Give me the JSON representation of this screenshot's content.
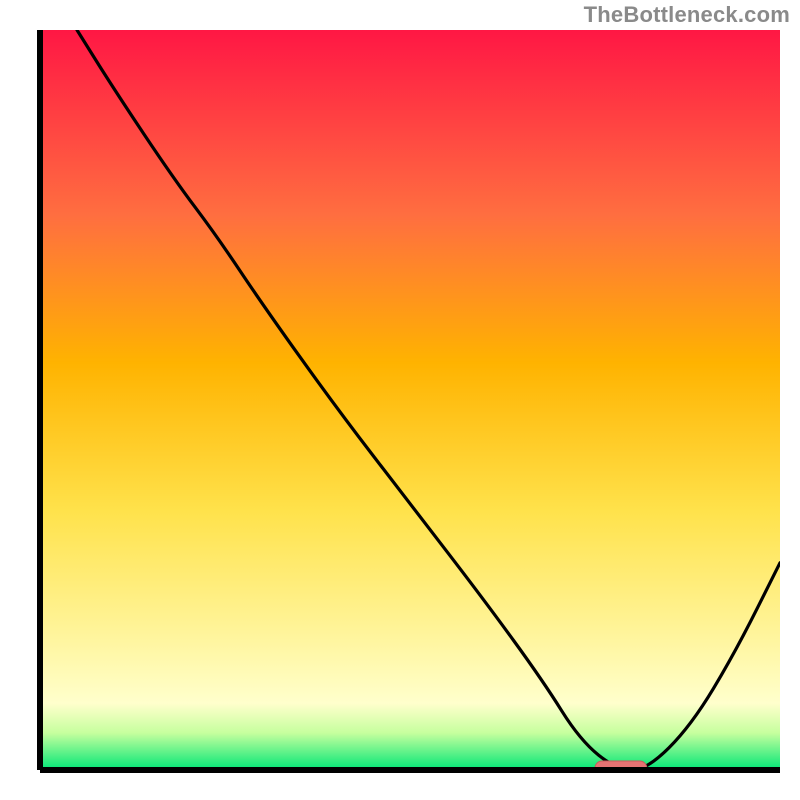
{
  "watermark": "TheBottleneck.com",
  "colors": {
    "gradient_top": "#ff1744",
    "gradient_upper_mid": "#ff8a3c",
    "gradient_mid": "#ffd740",
    "gradient_lower_mid": "#fff176",
    "gradient_pale": "#ffffcc",
    "gradient_bottom": "#00e676",
    "axis": "#000000",
    "curve": "#000000",
    "marker_fill": "#e57373",
    "marker_stroke": "#c75b5b"
  },
  "chart_data": {
    "type": "line",
    "title": "",
    "xlabel": "",
    "ylabel": "",
    "xlim": [
      0,
      100
    ],
    "ylim": [
      0,
      100
    ],
    "x": [
      5,
      10,
      18,
      24,
      30,
      40,
      50,
      60,
      68,
      73,
      78,
      82,
      88,
      94,
      100
    ],
    "values": [
      100,
      92,
      80,
      72,
      63,
      49,
      36,
      23,
      12,
      4,
      0,
      0,
      6,
      16,
      28
    ],
    "marker": {
      "x_start": 75,
      "x_end": 82,
      "y": 0
    },
    "annotations": []
  }
}
